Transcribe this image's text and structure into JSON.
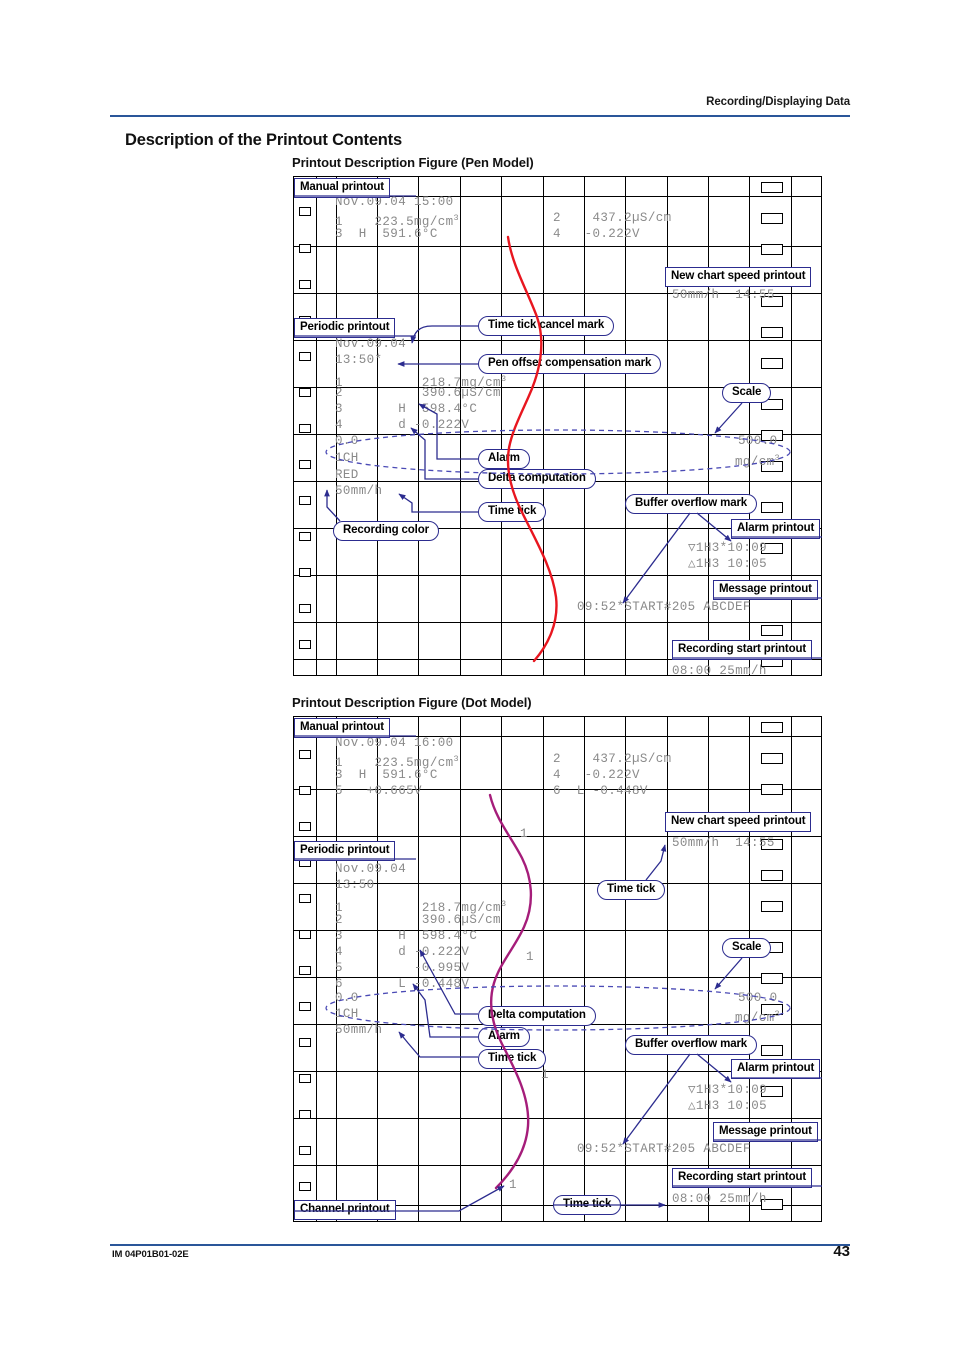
{
  "header": {
    "running_head": "Recording/Displaying Data"
  },
  "section": {
    "title": "Description of the Printout Contents"
  },
  "figures": [
    {
      "id": "pen",
      "title": "Printout Description Figure (Pen Model)",
      "trace_color": "#e8161f",
      "printed_text": {
        "manual_date": "Nov.09.04 15:00",
        "manual_rows": [
          "1    223.5mg/cm",
          "3  H  591.6°C"
        ],
        "manual_rows_right": [
          "2    437.2µS/cm",
          "4   -0.222V"
        ],
        "new_chart_speed": "50mm/h  14:55",
        "periodic_date": "Nov.09.04",
        "periodic_time": "13:50*",
        "periodic_rows": [
          "1          218.7mg/cm",
          "2          390.6µS/cm",
          "3       H  598.4°C",
          "4       d -0.222V"
        ],
        "scale_left": "0.0",
        "scale_right": "500.0",
        "scale_channel": "1CH",
        "scale_unit": "mg/cm",
        "recording_color": "RED",
        "chart_speed": "50mm/h",
        "alarm_rows": [
          "▽1H3*10:09",
          "△1H3 10:05"
        ],
        "message": "09:52*START#205 ABCDEF",
        "recording_start": "08:00 25mm/h"
      },
      "callouts": [
        {
          "name": "manual-printout",
          "label": "Manual printout",
          "shape": "box"
        },
        {
          "name": "new-chart-speed-printout",
          "label": "New chart speed printout",
          "shape": "box"
        },
        {
          "name": "periodic-printout",
          "label": "Periodic printout",
          "shape": "box"
        },
        {
          "name": "time-tick-cancel-mark",
          "label": "Time tick cancel mark",
          "shape": "pill"
        },
        {
          "name": "pen-offset-compensation-mark",
          "label": "Pen offset compensation mark",
          "shape": "pill"
        },
        {
          "name": "scale",
          "label": "Scale",
          "shape": "pill"
        },
        {
          "name": "alarm",
          "label": "Alarm",
          "shape": "pill"
        },
        {
          "name": "delta-computation",
          "label": "Delta computation",
          "shape": "pill"
        },
        {
          "name": "buffer-overflow-mark",
          "label": "Buffer overflow mark",
          "shape": "pill"
        },
        {
          "name": "time-tick",
          "label": "Time tick",
          "shape": "pill"
        },
        {
          "name": "recording-color",
          "label": "Recording color",
          "shape": "pill"
        },
        {
          "name": "alarm-printout",
          "label": "Alarm printout",
          "shape": "box"
        },
        {
          "name": "message-printout",
          "label": "Message printout",
          "shape": "box"
        },
        {
          "name": "recording-start-printout",
          "label": "Recording start printout",
          "shape": "box"
        }
      ]
    },
    {
      "id": "dot",
      "title": "Printout Description Figure (Dot Model)",
      "trace_color": "#a51d7a",
      "printed_text": {
        "manual_date": "Nov.09.04 16:00",
        "manual_rows": [
          "1    223.5mg/cm",
          "3  H  591.6°C",
          "5   +0.665V"
        ],
        "manual_rows_right": [
          "2    437.2µS/cm",
          "4   -0.222V",
          "6  L -0.448V"
        ],
        "new_chart_speed": "50mm/h  14:55",
        "periodic_date": "Nov.09.04",
        "periodic_time": "13:50",
        "periodic_rows": [
          "1          218.7mg/cm",
          "2          390.6µS/cm",
          "3       H  598.4°C",
          "4       d -0.222V",
          "5         -0.995V",
          "6       L -0.448V"
        ],
        "scale_left": "0.0",
        "scale_right": "500.0",
        "scale_channel": "1CH",
        "scale_unit": "mg/cm",
        "chart_speed": "50mm/h",
        "channel_marks": [
          "1",
          "1",
          "1",
          "1"
        ],
        "alarm_rows": [
          "▽1H3*10:09",
          "△1H3 10:05"
        ],
        "message": "09:52*START#205 ABCDEF",
        "recording_start": "08:00 25mm/h"
      },
      "callouts": [
        {
          "name": "manual-printout",
          "label": "Manual printout",
          "shape": "box"
        },
        {
          "name": "new-chart-speed-printout",
          "label": "New chart speed printout",
          "shape": "box"
        },
        {
          "name": "periodic-printout",
          "label": "Periodic printout",
          "shape": "box"
        },
        {
          "name": "time-tick-upper",
          "label": "Time tick",
          "shape": "pill"
        },
        {
          "name": "scale",
          "label": "Scale",
          "shape": "pill"
        },
        {
          "name": "delta-computation",
          "label": "Delta computation",
          "shape": "pill"
        },
        {
          "name": "alarm",
          "label": "Alarm",
          "shape": "pill"
        },
        {
          "name": "time-tick-mid",
          "label": "Time tick",
          "shape": "pill"
        },
        {
          "name": "buffer-overflow-mark",
          "label": "Buffer overflow mark",
          "shape": "pill"
        },
        {
          "name": "alarm-printout",
          "label": "Alarm printout",
          "shape": "box"
        },
        {
          "name": "message-printout",
          "label": "Message printout",
          "shape": "box"
        },
        {
          "name": "recording-start-printout",
          "label": "Recording start printout",
          "shape": "box"
        },
        {
          "name": "channel-printout",
          "label": "Channel printout",
          "shape": "box"
        },
        {
          "name": "time-tick-lower",
          "label": "Time tick",
          "shape": "pill"
        }
      ]
    }
  ],
  "footer": {
    "doc_id": "IM 04P01B01-02E",
    "page_number": "43"
  },
  "colors": {
    "rule": "#2a5699",
    "callout_border": "#2c2c8f",
    "leader": "#2c2c8f",
    "pen_trace": "#e8161f",
    "dot_trace": "#a51d7a",
    "printed_text": "#8a8a8a"
  }
}
